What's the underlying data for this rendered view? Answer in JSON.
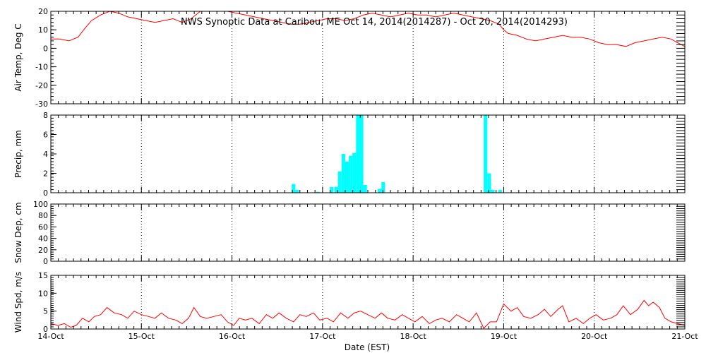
{
  "chart_data": {
    "title": "NWS Synoptic Data at Caribou, ME   Oct 14, 2014(2014287) - Oct 20, 2014(2014293)",
    "xlabel": "Date (EST)",
    "x_tick_labels": [
      "14-Oct",
      "15-Oct",
      "16-Oct",
      "17-Oct",
      "18-Oct",
      "19-Oct",
      "20-Oct",
      "21-Oct"
    ],
    "x_range_days": [
      0,
      7
    ],
    "colors": {
      "temp": "#ff0000",
      "precip": "#00ffff",
      "wind": "#ff0000",
      "axes": "#000000",
      "grid": "#000000"
    },
    "panels": [
      {
        "key": "temp",
        "type": "line",
        "ylabel": "Air Temp, Deg C",
        "ylim": [
          -30,
          20
        ],
        "yticks": [
          20,
          10,
          0,
          -10,
          -20,
          -30
        ],
        "series": [
          {
            "values": [
              [
                0.0,
                5
              ],
              [
                0.1,
                5
              ],
              [
                0.2,
                4
              ],
              [
                0.3,
                6
              ],
              [
                0.38,
                11
              ],
              [
                0.45,
                15
              ],
              [
                0.55,
                18
              ],
              [
                0.65,
                20
              ],
              [
                0.75,
                19
              ],
              [
                0.85,
                17
              ],
              [
                0.95,
                16
              ],
              [
                1.05,
                15
              ],
              [
                1.15,
                14
              ],
              [
                1.25,
                15
              ],
              [
                1.35,
                16
              ],
              [
                1.45,
                14
              ],
              [
                1.55,
                16
              ],
              [
                1.65,
                20
              ],
              [
                1.75,
                21
              ],
              [
                1.85,
                22
              ],
              [
                1.95,
                21
              ],
              [
                2.05,
                19
              ],
              [
                2.15,
                18
              ],
              [
                2.25,
                17
              ],
              [
                2.35,
                16
              ],
              [
                2.45,
                15
              ],
              [
                2.55,
                14
              ],
              [
                2.65,
                13
              ],
              [
                2.75,
                13
              ],
              [
                2.85,
                14
              ],
              [
                2.95,
                15
              ],
              [
                3.05,
                16
              ],
              [
                3.15,
                16
              ],
              [
                3.25,
                15
              ],
              [
                3.35,
                16
              ],
              [
                3.45,
                18
              ],
              [
                3.55,
                19
              ],
              [
                3.65,
                18
              ],
              [
                3.75,
                17
              ],
              [
                3.85,
                18
              ],
              [
                3.95,
                19
              ],
              [
                4.05,
                18
              ],
              [
                4.15,
                18
              ],
              [
                4.25,
                17
              ],
              [
                4.35,
                18
              ],
              [
                4.45,
                19
              ],
              [
                4.55,
                18
              ],
              [
                4.65,
                17
              ],
              [
                4.75,
                16
              ],
              [
                4.85,
                15
              ],
              [
                4.95,
                13
              ],
              [
                5.0,
                10
              ],
              [
                5.05,
                8
              ],
              [
                5.15,
                7
              ],
              [
                5.25,
                5
              ],
              [
                5.35,
                4
              ],
              [
                5.45,
                5
              ],
              [
                5.55,
                6
              ],
              [
                5.65,
                7
              ],
              [
                5.75,
                6
              ],
              [
                5.85,
                6
              ],
              [
                5.95,
                5
              ],
              [
                6.05,
                3
              ],
              [
                6.15,
                2
              ],
              [
                6.25,
                2
              ],
              [
                6.35,
                1
              ],
              [
                6.45,
                3
              ],
              [
                6.55,
                4
              ],
              [
                6.65,
                5
              ],
              [
                6.75,
                6
              ],
              [
                6.85,
                5
              ],
              [
                6.92,
                3
              ],
              [
                7.0,
                1
              ]
            ]
          }
        ]
      },
      {
        "key": "precip",
        "type": "bar",
        "ylabel": "Precip, mm",
        "ylim": [
          0,
          8
        ],
        "yticks": [
          8,
          6,
          4,
          2,
          0
        ],
        "series": [
          {
            "bar_width_days": 0.04,
            "values": [
              [
                2.68,
                0.9
              ],
              [
                2.72,
                0.3
              ],
              [
                2.95,
                0.1
              ],
              [
                3.1,
                0.6
              ],
              [
                3.15,
                0.6
              ],
              [
                3.19,
                2.2
              ],
              [
                3.23,
                4.0
              ],
              [
                3.27,
                3.2
              ],
              [
                3.31,
                3.8
              ],
              [
                3.35,
                4.1
              ],
              [
                3.39,
                9.0
              ],
              [
                3.43,
                12.0
              ],
              [
                3.47,
                0.8
              ],
              [
                3.63,
                0.4
              ],
              [
                3.67,
                1.1
              ],
              [
                4.8,
                8.7
              ],
              [
                4.84,
                2.0
              ],
              [
                4.88,
                0.3
              ],
              [
                4.96,
                0.3
              ]
            ]
          }
        ]
      },
      {
        "key": "snow",
        "type": "line",
        "ylabel": "Snow Dep, cm",
        "ylim": [
          0,
          100
        ],
        "yticks": [
          100,
          80,
          60,
          40,
          20,
          0
        ],
        "series": []
      },
      {
        "key": "wind",
        "type": "line",
        "ylabel": "Wind Spd, m/s",
        "ylim": [
          0,
          15
        ],
        "yticks": [
          15,
          10,
          5,
          0
        ],
        "series": [
          {
            "values": [
              [
                0.0,
                1.5
              ],
              [
                0.08,
                1.0
              ],
              [
                0.15,
                1.5
              ],
              [
                0.22,
                0.5
              ],
              [
                0.28,
                1.0
              ],
              [
                0.35,
                3.0
              ],
              [
                0.42,
                2.0
              ],
              [
                0.48,
                3.5
              ],
              [
                0.55,
                4.0
              ],
              [
                0.62,
                6.0
              ],
              [
                0.7,
                4.5
              ],
              [
                0.78,
                4.0
              ],
              [
                0.85,
                3.0
              ],
              [
                0.92,
                5.0
              ],
              [
                1.0,
                4.0
              ],
              [
                1.08,
                3.5
              ],
              [
                1.15,
                3.0
              ],
              [
                1.22,
                4.5
              ],
              [
                1.3,
                3.0
              ],
              [
                1.38,
                2.5
              ],
              [
                1.45,
                1.5
              ],
              [
                1.52,
                3.0
              ],
              [
                1.58,
                6.0
              ],
              [
                1.65,
                3.5
              ],
              [
                1.72,
                3.0
              ],
              [
                1.8,
                3.5
              ],
              [
                1.88,
                4.0
              ],
              [
                1.95,
                2.0
              ],
              [
                2.02,
                1.0
              ],
              [
                2.08,
                3.0
              ],
              [
                2.15,
                2.5
              ],
              [
                2.22,
                3.0
              ],
              [
                2.3,
                1.5
              ],
              [
                2.38,
                4.0
              ],
              [
                2.45,
                3.0
              ],
              [
                2.52,
                4.5
              ],
              [
                2.6,
                3.0
              ],
              [
                2.68,
                2.0
              ],
              [
                2.75,
                4.0
              ],
              [
                2.82,
                3.5
              ],
              [
                2.9,
                4.5
              ],
              [
                2.97,
                2.5
              ],
              [
                3.05,
                3.0
              ],
              [
                3.12,
                2.0
              ],
              [
                3.2,
                4.5
              ],
              [
                3.28,
                3.0
              ],
              [
                3.35,
                4.5
              ],
              [
                3.42,
                5.0
              ],
              [
                3.5,
                4.0
              ],
              [
                3.58,
                3.0
              ],
              [
                3.65,
                4.5
              ],
              [
                3.72,
                3.0
              ],
              [
                3.8,
                2.5
              ],
              [
                3.88,
                4.0
              ],
              [
                3.95,
                3.0
              ],
              [
                4.02,
                2.0
              ],
              [
                4.1,
                3.5
              ],
              [
                4.18,
                1.5
              ],
              [
                4.25,
                2.5
              ],
              [
                4.32,
                3.0
              ],
              [
                4.4,
                2.0
              ],
              [
                4.48,
                4.0
              ],
              [
                4.55,
                3.0
              ],
              [
                4.62,
                2.0
              ],
              [
                4.7,
                4.5
              ],
              [
                4.78,
                0.2
              ],
              [
                4.85,
                2.0
              ],
              [
                4.92,
                2.0
              ],
              [
                5.0,
                7.0
              ],
              [
                5.08,
                5.0
              ],
              [
                5.15,
                6.0
              ],
              [
                5.22,
                3.5
              ],
              [
                5.3,
                3.0
              ],
              [
                5.38,
                4.0
              ],
              [
                5.45,
                5.5
              ],
              [
                5.52,
                3.5
              ],
              [
                5.6,
                5.5
              ],
              [
                5.65,
                6.5
              ],
              [
                5.72,
                2.0
              ],
              [
                5.8,
                3.0
              ],
              [
                5.88,
                1.5
              ],
              [
                5.95,
                3.0
              ],
              [
                6.02,
                4.0
              ],
              [
                6.1,
                2.5
              ],
              [
                6.18,
                3.0
              ],
              [
                6.25,
                4.0
              ],
              [
                6.32,
                6.5
              ],
              [
                6.4,
                4.0
              ],
              [
                6.48,
                5.5
              ],
              [
                6.55,
                8.0
              ],
              [
                6.6,
                6.5
              ],
              [
                6.65,
                7.5
              ],
              [
                6.72,
                6.0
              ],
              [
                6.78,
                3.0
              ],
              [
                6.85,
                2.0
              ],
              [
                6.92,
                1.5
              ],
              [
                7.0,
                1.0
              ]
            ]
          }
        ]
      }
    ]
  }
}
